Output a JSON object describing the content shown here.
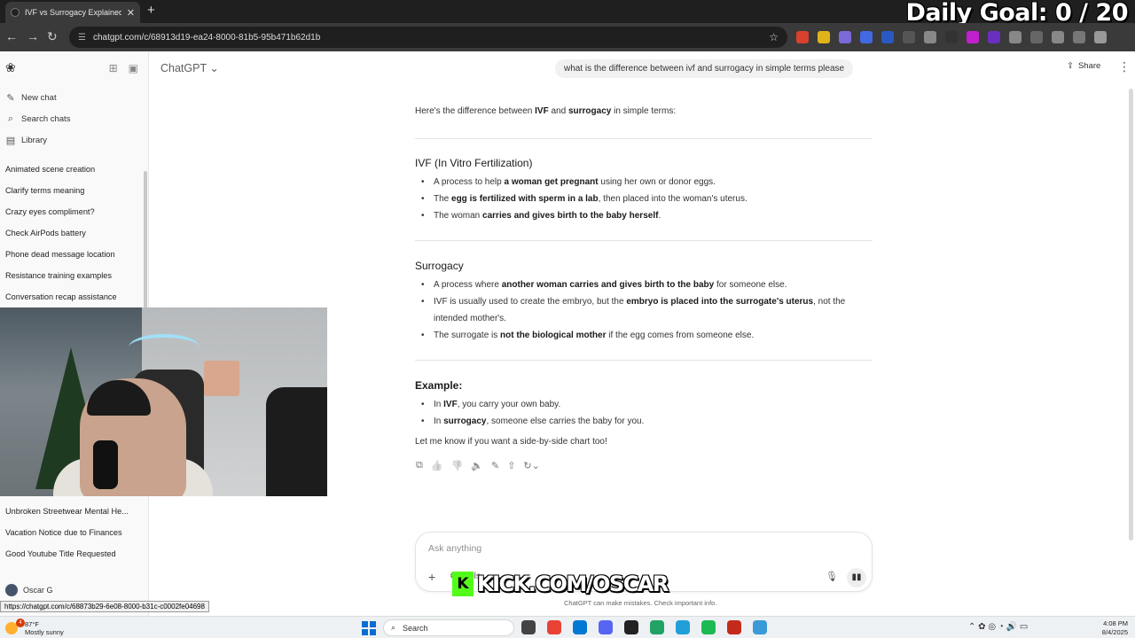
{
  "browser": {
    "tab_title": "IVF vs Surrogacy Explained",
    "tab_close": "✕",
    "new_tab": "+",
    "url": "chatgpt.com/c/68913d19-ea24-8000-81b5-95b471b62d1b",
    "back": "←",
    "forward": "→",
    "reload": "↻",
    "lock": "☰",
    "star": "☆",
    "extension_colors": [
      "#d9412f",
      "#e0b31a",
      "#7a6ad8",
      "#4169e1",
      "#2b59c3",
      "#555555",
      "#888888",
      "#333333",
      "#c21fcf",
      "#6b2fbf",
      "#888888",
      "#666666",
      "#888888",
      "#777777",
      "#999999"
    ]
  },
  "overlay": {
    "goal_text": "Daily Goal:  0 / 20",
    "kick_logo": "K",
    "kick_text": "KICK.COM/OSCAR"
  },
  "sidebar": {
    "logo": "❀",
    "icon_grid": "⊞",
    "icon_toggle": "▣",
    "nav": [
      {
        "label": "New chat",
        "icon": "✎"
      },
      {
        "label": "Search chats",
        "icon": "⌕"
      },
      {
        "label": "Library",
        "icon": "▤"
      }
    ],
    "chats_top": [
      "Animated scene creation",
      "Clarify terms meaning",
      "Crazy eyes compliment?",
      "Check AirPods battery",
      "Phone dead message location",
      "Resistance training examples",
      "Conversation recap assistance"
    ],
    "chats_bottom": [
      "Unbroken Streetwear Mental He...",
      "Vacation Notice due to Finances",
      "Good Youtube Title Requested"
    ],
    "user_name": "Oscar G",
    "status_url": "https://chatgpt.com/c/68873b29-6e08-8000-b31c-c0002fe04698"
  },
  "header": {
    "title": "ChatGPT",
    "chevron": "⌄",
    "share_icon": "⇪",
    "share_label": "Share",
    "more": "⋮"
  },
  "conversation": {
    "user_message": "what is the difference between ivf and surrogacy in simple terms please",
    "intro": {
      "a": "Here's the difference between ",
      "b1": "IVF",
      "c": " and ",
      "b2": "surrogacy",
      "d": " in simple terms:"
    },
    "ivf": {
      "heading": "IVF (In Vitro Fertilization)",
      "b1": {
        "a": "A process to help ",
        "b": "a woman get pregnant",
        "c": " using her own or donor eggs."
      },
      "b2": {
        "a": "The ",
        "b": "egg is fertilized with sperm in a lab",
        "c": ", then placed into the woman's uterus."
      },
      "b3": {
        "a": "The woman ",
        "b": "carries and gives birth to the baby herself",
        "c": "."
      }
    },
    "surrogacy": {
      "heading": "Surrogacy",
      "b1": {
        "a": "A process where ",
        "b": "another woman carries and gives birth to the baby",
        "c": " for someone else."
      },
      "b2": {
        "a": "IVF is usually used to create the embryo, but the ",
        "b": "embryo is placed into the surrogate's uterus",
        "c": ", not the intended mother's."
      },
      "b3": {
        "a": "The surrogate is ",
        "b": "not the biological mother",
        "c": " if the egg comes from someone else."
      }
    },
    "example": {
      "heading": "Example:",
      "b1": {
        "a": "In ",
        "b": "IVF",
        "c": ", you carry your own baby."
      },
      "b2": {
        "a": "In ",
        "b": "surrogacy",
        "c": ", someone else carries the baby for you."
      }
    },
    "closing": "Let me know if you want a side-by-side chart too!",
    "action_icons": {
      "copy": "⧉",
      "like": "👍",
      "dislike": "👎",
      "read": "🔈",
      "edit": "✎",
      "share": "⇧",
      "regen": "↻⌄"
    }
  },
  "composer": {
    "placeholder": "Ask anything",
    "plus": "+",
    "tools": "⚙ Tools",
    "mic": "🎙",
    "voice": "▮▮",
    "disclaimer": "ChatGPT can make mistakes. Check important info."
  },
  "taskbar": {
    "weather_temp": "87°F",
    "weather_desc": "Mostly sunny",
    "weather_badge": "4",
    "search_icon": "⌕",
    "search_label": "Search",
    "app_colors": [
      "#444444",
      "#e94235",
      "#0078d4",
      "#5865f2",
      "#222222",
      "#21a366",
      "#229ed9",
      "#1db954",
      "#c42b1c",
      "#3a9bd8"
    ],
    "tray_icons": "⌃  ✿  ◎  ◔  🔊  ▭",
    "time": "4:08 PM",
    "date": "8/4/2025"
  }
}
